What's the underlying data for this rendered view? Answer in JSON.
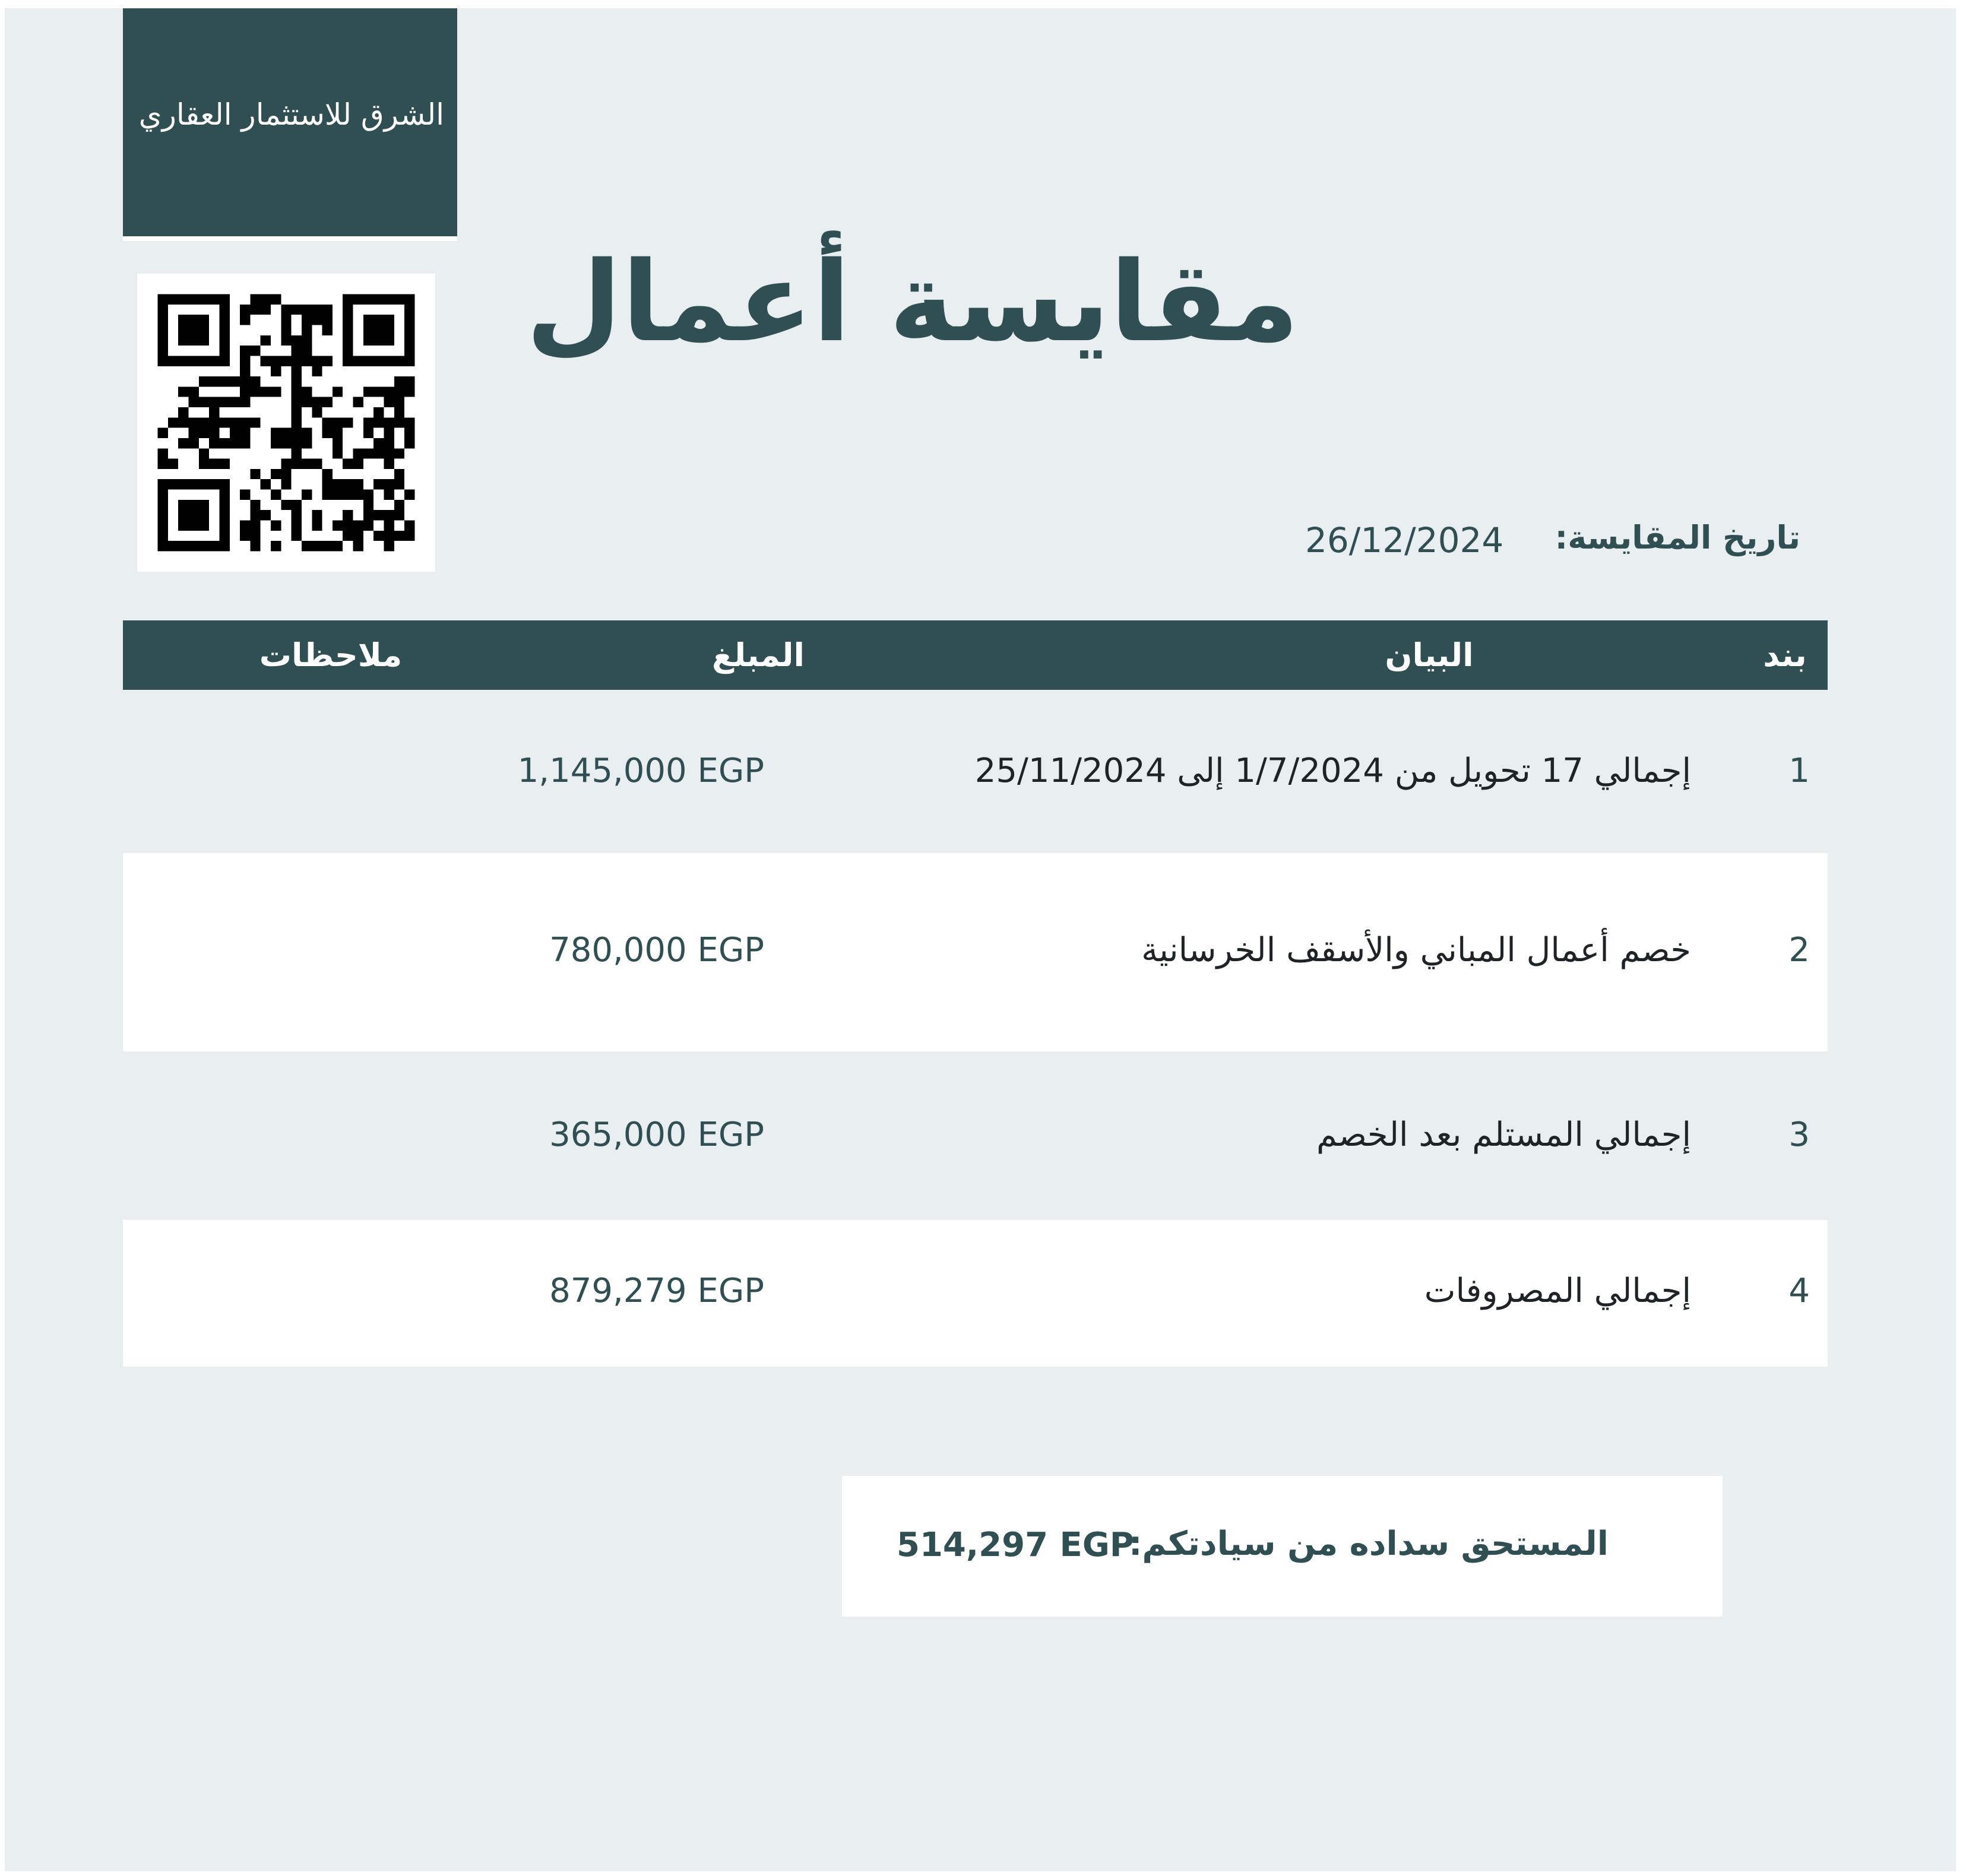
{
  "company": {
    "name": "الشرق للاستثمار العقاري"
  },
  "document": {
    "title": "مقايسة أعمال",
    "date_label": "تاريخ المقايسة:",
    "date_value": "26/12/2024"
  },
  "table": {
    "headers": {
      "item": "بند",
      "description": "البيان",
      "amount": "المبلغ",
      "notes": "ملاحظات"
    },
    "rows": [
      {
        "item": "1",
        "description": "إجمالي 17 تحويل من 1/7/2024 إلى 25/11/2024",
        "amount": "1,145,000 EGP",
        "notes": ""
      },
      {
        "item": "2",
        "description": "خصم أعمال المباني والأسقف الخرسانية",
        "amount": "780,000 EGP",
        "notes": ""
      },
      {
        "item": "3",
        "description": "إجمالي المستلم بعد الخصم",
        "amount": "365,000 EGP",
        "notes": ""
      },
      {
        "item": "4",
        "description": "إجمالي المصروفات",
        "amount": "879,279 EGP",
        "notes": ""
      }
    ]
  },
  "summary": {
    "label": "المستحق سداده من سيادتكم:",
    "value": "514,297 EGP"
  },
  "colors": {
    "primary": "#2f4f53",
    "background": "#e9eef0",
    "row_alt": "#ffffff",
    "text": "#1e2426"
  },
  "icons": {
    "qr": "qr-code-icon"
  }
}
